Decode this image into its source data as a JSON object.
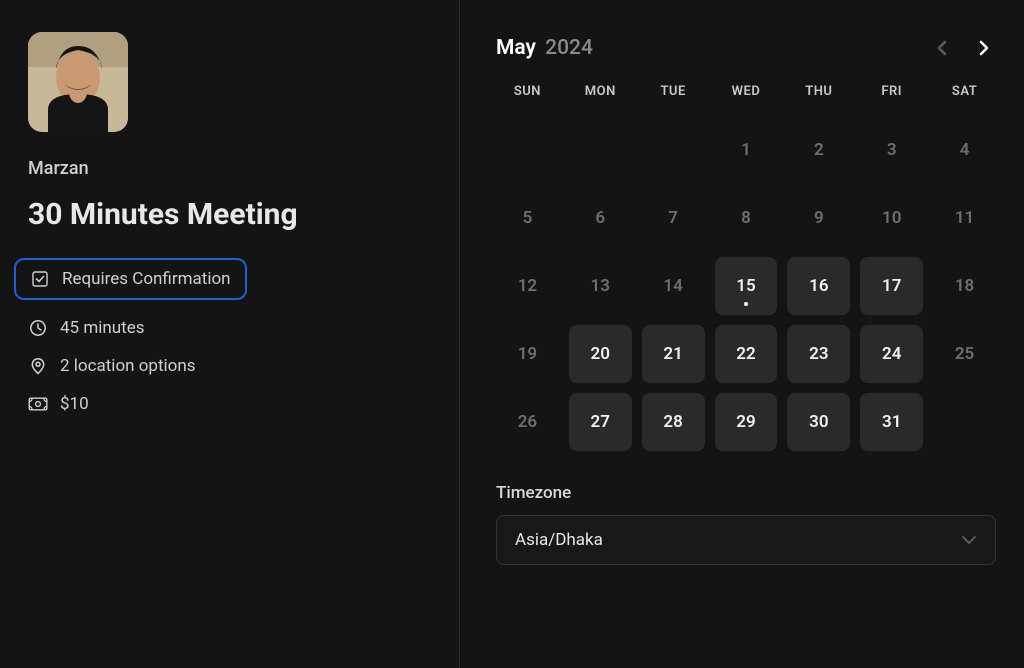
{
  "host": {
    "name": "Marzan"
  },
  "meeting": {
    "title": "30 Minutes Meeting",
    "confirmation_label": "Requires Confirmation",
    "duration_label": "45 minutes",
    "location_label": "2 location options",
    "price_label": "$10"
  },
  "calendar": {
    "month": "May",
    "year": "2024",
    "dow": [
      "SUN",
      "MON",
      "TUE",
      "WED",
      "THU",
      "FRI",
      "SAT"
    ],
    "days": [
      {
        "n": null
      },
      {
        "n": null
      },
      {
        "n": null
      },
      {
        "n": 1
      },
      {
        "n": 2
      },
      {
        "n": 3
      },
      {
        "n": 4
      },
      {
        "n": 5
      },
      {
        "n": 6
      },
      {
        "n": 7
      },
      {
        "n": 8
      },
      {
        "n": 9
      },
      {
        "n": 10
      },
      {
        "n": 11
      },
      {
        "n": 12
      },
      {
        "n": 13
      },
      {
        "n": 14
      },
      {
        "n": 15,
        "avail": true,
        "today": true
      },
      {
        "n": 16,
        "avail": true
      },
      {
        "n": 17,
        "avail": true
      },
      {
        "n": 18
      },
      {
        "n": 19
      },
      {
        "n": 20,
        "avail": true
      },
      {
        "n": 21,
        "avail": true
      },
      {
        "n": 22,
        "avail": true
      },
      {
        "n": 23,
        "avail": true
      },
      {
        "n": 24,
        "avail": true
      },
      {
        "n": 25
      },
      {
        "n": 26
      },
      {
        "n": 27,
        "avail": true
      },
      {
        "n": 28,
        "avail": true
      },
      {
        "n": 29,
        "avail": true
      },
      {
        "n": 30,
        "avail": true
      },
      {
        "n": 31,
        "avail": true
      }
    ]
  },
  "timezone": {
    "label": "Timezone",
    "selected": "Asia/Dhaka"
  }
}
